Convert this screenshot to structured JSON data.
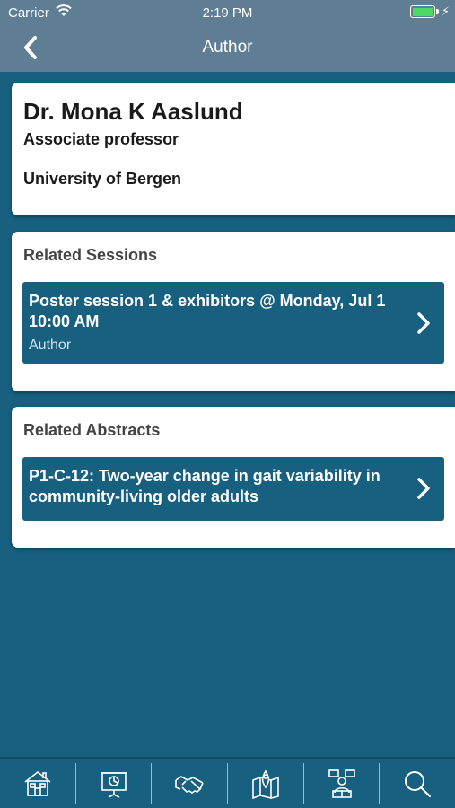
{
  "status_bar": {
    "carrier": "Carrier",
    "time": "2:19 PM",
    "battery_color": "#4cd964"
  },
  "nav": {
    "back_icon": "chevron-left-icon",
    "title": "Author"
  },
  "author": {
    "name": "Dr. Mona K Aaslund",
    "role": "Associate professor",
    "organization": "University of Bergen"
  },
  "related_sessions": {
    "title": "Related Sessions",
    "items": [
      {
        "title": "Poster session 1 & exhibitors @ Monday, Jul 1 10:00 AM",
        "subtitle": "Author"
      }
    ]
  },
  "related_abstracts": {
    "title": "Related Abstracts",
    "items": [
      {
        "title": "P1-C-12: Two-year change in gait variability in community-living older adults"
      }
    ]
  },
  "tabbar": {
    "tabs": [
      {
        "icon": "home-icon"
      },
      {
        "icon": "presentation-icon"
      },
      {
        "icon": "handshake-icon"
      },
      {
        "icon": "map-icon"
      },
      {
        "icon": "speaker-icon"
      },
      {
        "icon": "search-icon"
      }
    ]
  },
  "colors": {
    "background": "#17607f",
    "header": "#5f7d93",
    "card": "#ffffff"
  }
}
